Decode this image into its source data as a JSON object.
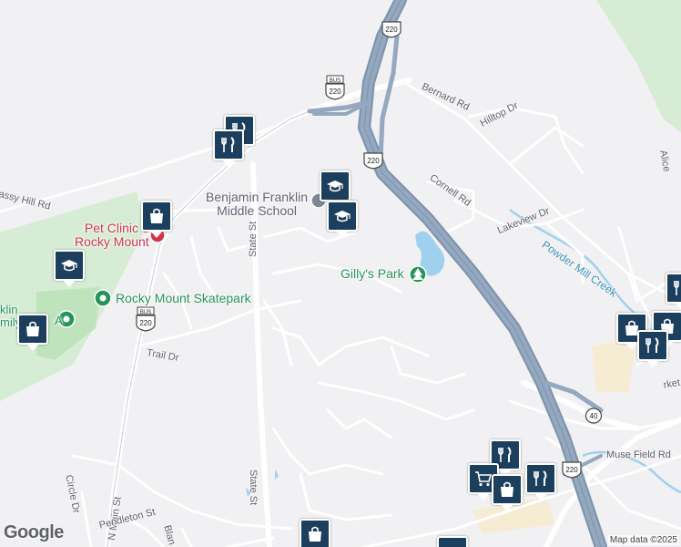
{
  "map": {
    "street_labels": {
      "bernard_rd": "Bernard Rd",
      "hilltop_dr": "Hilltop Dr",
      "cornell_rd": "Cornell Rd",
      "lakeview_dr": "Lakeview Dr",
      "state_st_north": "State St",
      "state_st_south": "State St",
      "grassy_hill_rd": "assy Hill Rd",
      "trail_dr": "Trail Dr",
      "n_main_st": "N Main St",
      "circle_dr": "Circle Dr",
      "pendleton_st": "Pendleton St",
      "bland_st": "Blan",
      "muse_field_rd": "Muse Field Rd",
      "market_st": "rket",
      "alice": "Alice"
    },
    "water_labels": {
      "powder_mill_creek": "Powder Mill Creek"
    },
    "route_shields": {
      "us220_top": "220",
      "bus220_top_tag": "BUS",
      "bus220_top": "220",
      "us220_mid": "220",
      "bus220_left_tag": "BUS",
      "bus220_left": "220",
      "rt40": "40",
      "us220_bottom": "220"
    },
    "poi_labels": {
      "school_line1": "Benjamin Franklin",
      "school_line2": "Middle School",
      "park": "Gilly's Park",
      "vet_line1": "Pet Clinic o",
      "vet_line2": "Rocky Mount",
      "skatepark": "Rocky Mount Skatepark",
      "ymca_line1": "klin",
      "ymca_line2": "mily",
      "ymca_line3": "A"
    },
    "markers": [
      {
        "icon": "restaurant-icon",
        "label": "restaurant"
      },
      {
        "icon": "restaurant-icon",
        "label": "restaurant"
      },
      {
        "icon": "school-icon",
        "label": "school"
      },
      {
        "icon": "school-icon",
        "label": "school"
      },
      {
        "icon": "shopping-bag-icon",
        "label": "shopping"
      },
      {
        "icon": "school-icon",
        "label": "school"
      },
      {
        "icon": "shopping-bag-icon",
        "label": "shopping"
      },
      {
        "icon": "restaurant-icon",
        "label": "restaurant"
      },
      {
        "icon": "shopping-bag-icon",
        "label": "shopping"
      },
      {
        "icon": "shopping-bag-icon",
        "label": "shopping"
      },
      {
        "icon": "restaurant-icon",
        "label": "restaurant"
      },
      {
        "icon": "restaurant-icon",
        "label": "restaurant"
      },
      {
        "icon": "shopping-cart-icon",
        "label": "grocery"
      },
      {
        "icon": "shopping-bag-icon",
        "label": "shopping"
      },
      {
        "icon": "restaurant-icon",
        "label": "restaurant"
      },
      {
        "icon": "shopping-bag-icon",
        "label": "shopping"
      }
    ],
    "attribution": "Map data ©2025",
    "logo": "Google",
    "colors": {
      "background": "#f1f0f2",
      "highway": "#8a9fb8",
      "road": "#ffffff",
      "park": "#cfe9cf",
      "water": "#9fd1ee",
      "marker": "#1d3f5e",
      "park_poi": "#25955a",
      "vet_poi": "#d6334a"
    }
  }
}
